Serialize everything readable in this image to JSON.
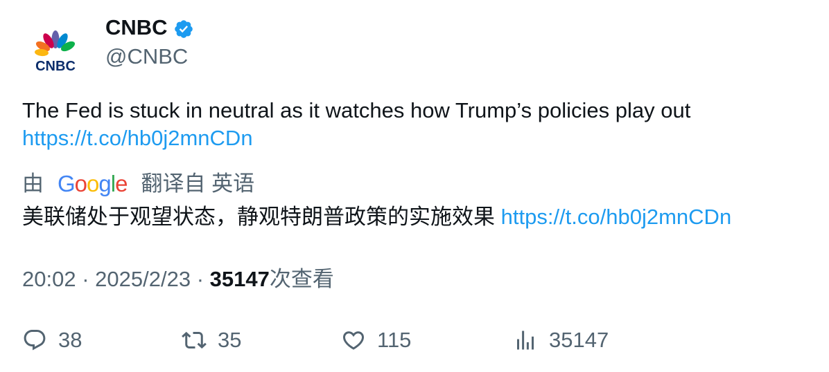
{
  "author": {
    "display_name": "CNBC",
    "handle": "@CNBC",
    "avatar_icon": "cnbc-peacock-logo",
    "avatar_text": "CNBC",
    "verified": true
  },
  "tweet": {
    "text": "The Fed is stuck in neutral as it watches how Trump’s policies play out",
    "link": "https://t.co/hb0j2mnCDn"
  },
  "translation": {
    "by_label": "由",
    "provider": "Google",
    "from_label": "翻译自 英语",
    "text": "美联储处于观望状态，静观特朗普政策的实施效果",
    "link": "https://t.co/hb0j2mnCDn"
  },
  "meta": {
    "time": "20:02",
    "date": "2025/2/23",
    "separator": "·",
    "views_count": "35147",
    "views_label": "次查看"
  },
  "actions": {
    "replies": "38",
    "retweets": "35",
    "likes": "115",
    "views": "35147"
  },
  "colors": {
    "link": "#1d9bf0",
    "secondary_text": "#536471",
    "primary_text": "#0f1419",
    "verified_badge": "#1d9bf0"
  }
}
